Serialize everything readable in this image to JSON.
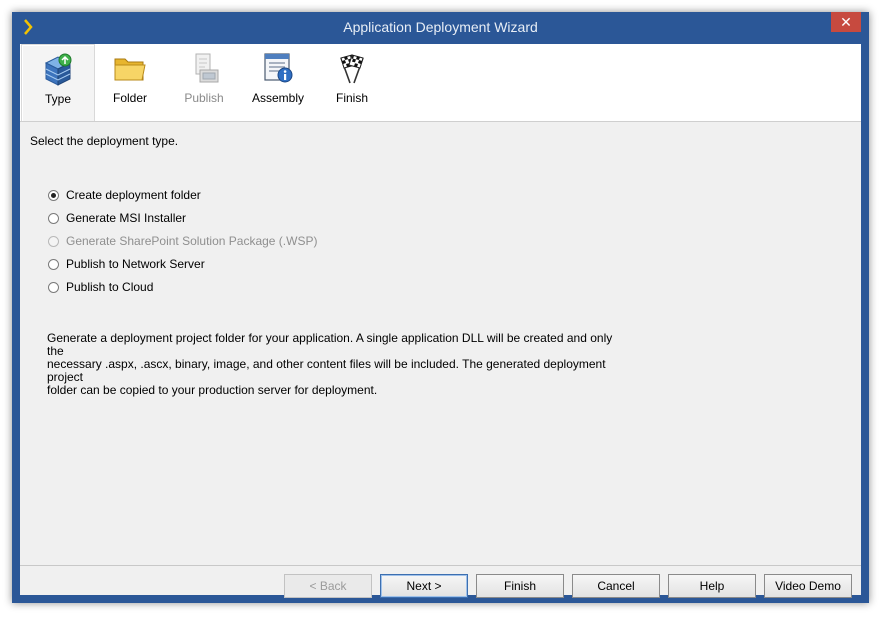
{
  "window": {
    "title": "Application Deployment Wizard",
    "close_glyph": "✕",
    "accent_color": "#2b5797"
  },
  "steps": [
    {
      "label": "Type",
      "icon": "stack-box-icon",
      "active": true,
      "enabled": true
    },
    {
      "label": "Folder",
      "icon": "folder-icon",
      "active": false,
      "enabled": true
    },
    {
      "label": "Publish",
      "icon": "publish-icon",
      "active": false,
      "enabled": false
    },
    {
      "label": "Assembly",
      "icon": "assembly-info-icon",
      "active": false,
      "enabled": true
    },
    {
      "label": "Finish",
      "icon": "checkered-flags-icon",
      "active": false,
      "enabled": true
    }
  ],
  "content": {
    "instruction": "Select the deployment type.",
    "options": [
      {
        "label": "Create deployment folder",
        "checked": true,
        "enabled": true
      },
      {
        "label": "Generate MSI Installer",
        "checked": false,
        "enabled": true
      },
      {
        "label": "Generate SharePoint Solution Package (.WSP)",
        "checked": false,
        "enabled": false
      },
      {
        "label": "Publish to Network Server",
        "checked": false,
        "enabled": true
      },
      {
        "label": "Publish to Cloud",
        "checked": false,
        "enabled": true
      }
    ],
    "description_lines": [
      "Generate a deployment project folder for your application. A single application DLL will be created and only the",
      "necessary .aspx, .ascx, binary, image, and other content files will be included.  The generated deployment project",
      "folder can be copied to your production server for deployment."
    ]
  },
  "buttons": {
    "back": "< Back",
    "next": "Next >",
    "finish": "Finish",
    "cancel": "Cancel",
    "help": "Help",
    "video_demo": "Video Demo"
  }
}
